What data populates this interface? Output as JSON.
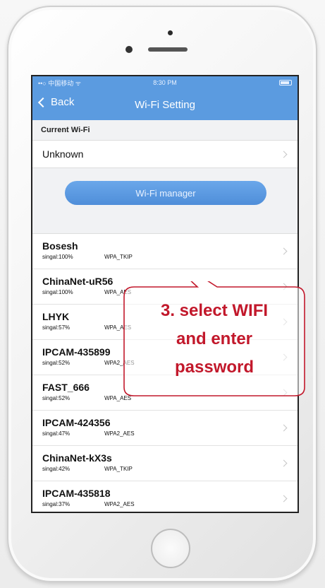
{
  "status_bar": {
    "carrier": "••○ 中国移动 ᯤ",
    "time": "8:30 PM"
  },
  "nav": {
    "back_label": "Back",
    "title": "Wi-Fi Setting"
  },
  "current_wifi": {
    "section_label": "Current Wi-Fi",
    "name": "Unknown"
  },
  "wifi_manager_label": "Wi-Fi manager",
  "networks": [
    {
      "name": "Bosesh",
      "signal": "singal:100%",
      "security": "WPA_TKIP"
    },
    {
      "name": "ChinaNet-uR56",
      "signal": "singal:100%",
      "security": "WPA_AES"
    },
    {
      "name": "LHYK",
      "signal": "singal:57%",
      "security": "WPA_AES"
    },
    {
      "name": "IPCAM-435899",
      "signal": "singal:52%",
      "security": "WPA2_AES"
    },
    {
      "name": "FAST_666",
      "signal": "singal:52%",
      "security": "WPA_AES"
    },
    {
      "name": "IPCAM-424356",
      "signal": "singal:47%",
      "security": "WPA2_AES"
    },
    {
      "name": "ChinaNet-kX3s",
      "signal": "singal:42%",
      "security": "WPA_TKIP"
    },
    {
      "name": "IPCAM-435818",
      "signal": "singal:37%",
      "security": "WPA2_AES"
    }
  ],
  "annotation": {
    "line1": "3. select WIFI",
    "line2": "and enter",
    "line3": "password"
  },
  "colors": {
    "nav_blue": "#5b9be0",
    "annotation_red": "#c2182b"
  }
}
